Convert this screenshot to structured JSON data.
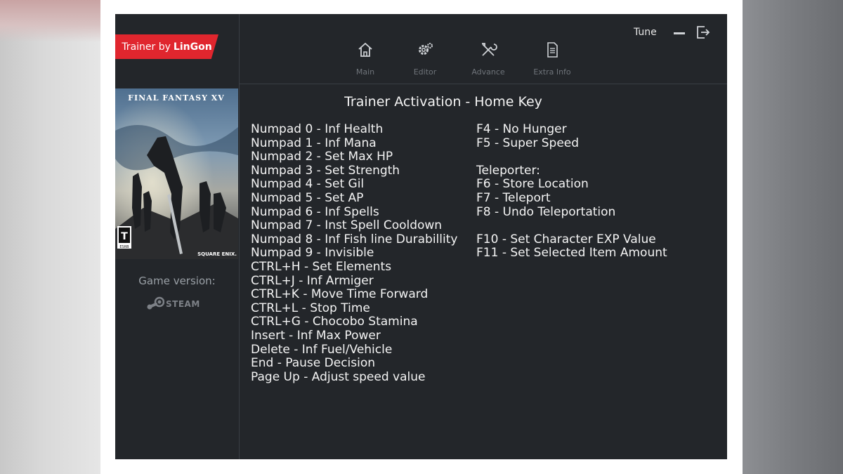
{
  "trainer": {
    "brand_prefix": "Trainer by",
    "brand_name": "LinGon",
    "game_version_label": "Game version:",
    "platform": "STEAM",
    "cover": {
      "title": "FINAL FANTASY XV",
      "rating": "T",
      "rating_footer": "ESRB",
      "publisher": "SQUARE ENIX."
    }
  },
  "nav": {
    "items": [
      {
        "label": "Main",
        "icon": "home-icon"
      },
      {
        "label": "Editor",
        "icon": "gear-icon"
      },
      {
        "label": "Advance",
        "icon": "tools-icon"
      },
      {
        "label": "Extra Info",
        "icon": "document-icon"
      }
    ]
  },
  "window": {
    "tune_label": "Tune"
  },
  "content": {
    "title": "Trainer Activation - Home Key",
    "left_column": [
      "Numpad 0 - Inf Health",
      "Numpad 1 - Inf Mana",
      "Numpad 2 - Set Max HP",
      "Numpad 3 - Set Strength",
      "Numpad 4 - Set Gil",
      "Numpad 5 - Set AP",
      "Numpad 6 - Inf Spells",
      "Numpad 7 - Inst Spell Cooldown",
      "Numpad 8 - Inf Fish line Durabillity",
      "Numpad 9 - Invisible",
      "CTRL+H - Set Elements",
      "CTRL+J - Inf Armiger",
      "CTRL+K - Move Time Forward",
      "CTRL+L - Stop Time",
      "CTRL+G - Chocobo Stamina",
      "Insert - Inf Max Power",
      "Delete - Inf Fuel/Vehicle",
      "End - Pause Decision",
      "Page Up - Adjust speed value"
    ],
    "right_column": [
      "F4 - No Hunger",
      "F5 - Super Speed",
      "",
      "Teleporter:",
      "F6 - Store Location",
      "F7 - Teleport",
      "F8 - Undo Teleportation",
      "",
      "F10 - Set Character EXP Value",
      "F11 - Set Selected Item Amount"
    ]
  },
  "colors": {
    "window_bg": "#23262a",
    "brand_red": "#e0262e",
    "text": "#f4f4f4",
    "muted": "#9aa0a6"
  }
}
